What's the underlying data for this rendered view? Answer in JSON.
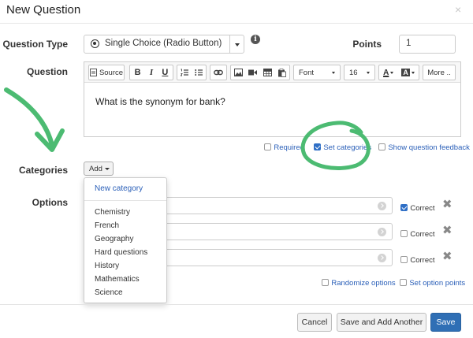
{
  "dialog": {
    "title": "New Question",
    "close_glyph": "×"
  },
  "form": {
    "question_type_label": "Question Type",
    "question_type_value": "Single Choice (Radio Button)",
    "points_label": "Points",
    "points_value": "1",
    "question_label": "Question",
    "question_text": "What is the synonym for bank?",
    "categories_label": "Categories",
    "add_button_label": "Add",
    "options_label": "Options"
  },
  "toolbar": {
    "source_label": "Source",
    "bold": "B",
    "italic": "I",
    "underline": "U",
    "font_label": "Font",
    "size_value": "16",
    "font_color_letter": "A",
    "bg_color_letter": "A",
    "more_label": "More .."
  },
  "editor_options": {
    "required_label": "Required",
    "set_categories_label": "Set categories",
    "show_feedback_label": "Show question feedback"
  },
  "categories_menu": {
    "new_category": "New category",
    "items": [
      "Chemistry",
      "French",
      "Geography",
      "Hard questions",
      "History",
      "Mathematics",
      "Science"
    ]
  },
  "options": [
    {
      "correct_label": "Correct",
      "checked": true
    },
    {
      "correct_label": "Correct",
      "checked": false
    },
    {
      "correct_label": "Correct",
      "checked": false
    }
  ],
  "option_footer": {
    "randomize_label": "Randomize options",
    "set_points_label": "Set option points"
  },
  "buttons": {
    "cancel": "Cancel",
    "save_and_add": "Save and Add Another",
    "save": "Save"
  },
  "colors": {
    "annotation_green": "#4cbb72",
    "primary_blue": "#2f6fb5",
    "link_blue": "#2a5fb8"
  }
}
